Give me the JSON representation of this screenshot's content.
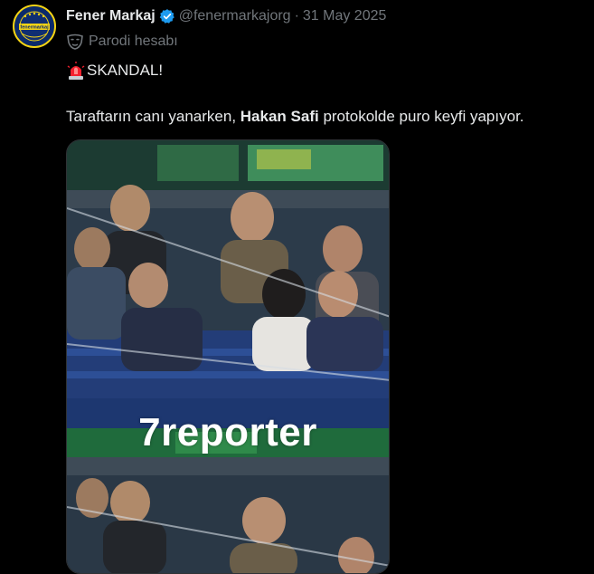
{
  "author": {
    "display_name": "Fener Markaj",
    "handle": "@fenermarkajorg",
    "separator": "·",
    "date": "31 May 2025",
    "avatar_text": "fenermarkaj",
    "parody_label": "Parodi hesabı"
  },
  "tweet": {
    "line1": "SKANDAL!",
    "line2_prefix": "Taraftarın canı yanarken, ",
    "line2_bold": "Hakan Safi",
    "line2_suffix": " protokolde puro keyfi yapıyor."
  },
  "media": {
    "watermark": "7reporter"
  },
  "colors": {
    "background": "#000000",
    "text": "#e7e9ea",
    "muted": "#71767b",
    "verified": "#1d9bf0",
    "siren": "#f4212e"
  },
  "icons": [
    "verified-badge-icon",
    "parody-mask-icon",
    "siren-emoji-icon"
  ]
}
